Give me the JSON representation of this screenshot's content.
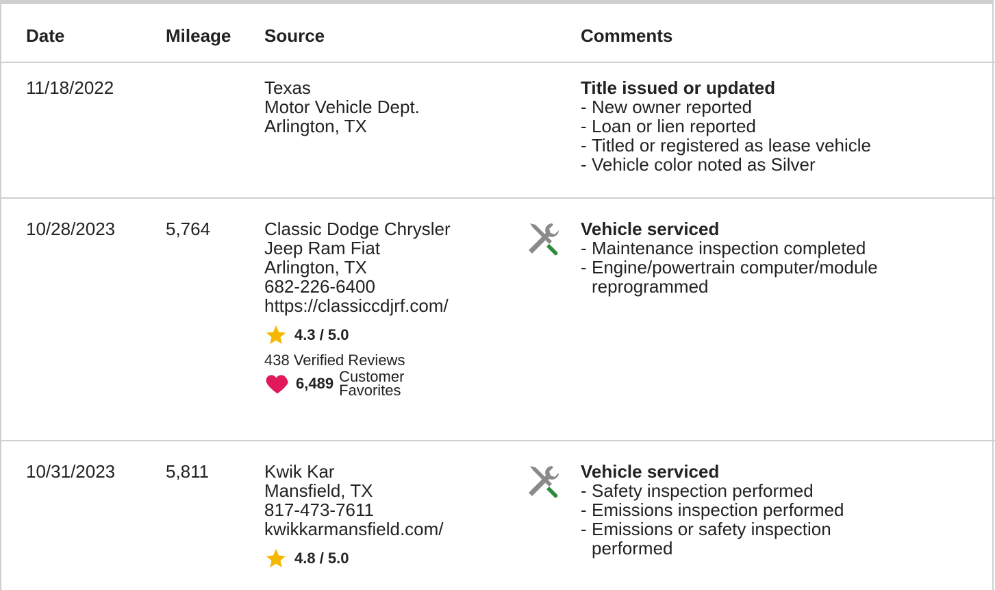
{
  "table": {
    "headers": {
      "date": "Date",
      "mileage": "Mileage",
      "source": "Source",
      "comments": "Comments"
    },
    "rows": [
      {
        "date": "11/18/2022",
        "mileage": "",
        "source": [
          "Texas",
          "Motor Vehicle Dept.",
          "Arlington, TX"
        ],
        "comment_title": "Title issued or updated",
        "comment_items": [
          "New owner reported",
          "Loan or lien reported",
          "Titled or registered as lease vehicle",
          "Vehicle color noted as Silver"
        ]
      },
      {
        "date": "10/28/2023",
        "mileage": "5,764",
        "source": [
          "Classic Dodge Chrysler",
          "Jeep Ram Fiat",
          "Arlington, TX",
          "682-226-6400",
          "https://classiccdjrf.com/"
        ],
        "rating": "4.3 / 5.0",
        "reviews": "438 Verified Reviews",
        "favorites_count": "6,489",
        "favorites_label_1": "Customer",
        "favorites_label_2": "Favorites",
        "comment_title": "Vehicle serviced",
        "comment_items": [
          "Maintenance inspection completed",
          "Engine/powertrain computer/module",
          "reprogrammed"
        ]
      },
      {
        "date": "10/31/2023",
        "mileage": "5,811",
        "source": [
          "Kwik Kar",
          "Mansfield, TX",
          "817-473-7611",
          "kwikkarmansfield.com/"
        ],
        "rating": "4.8 / 5.0",
        "comment_title": "Vehicle serviced",
        "comment_items": [
          "Safety inspection performed",
          "Emissions inspection performed",
          "Emissions or safety inspection",
          "performed"
        ]
      }
    ]
  },
  "icons": {
    "service": "wrench-screwdriver-icon",
    "star": "star-icon",
    "heart": "heart-icon"
  },
  "colors": {
    "star": "#f5b700",
    "heart": "#e0195a",
    "screwdriver_handle": "#2e8b3e",
    "tool_gray": "#8a8a8a",
    "border": "#cfcfcf"
  }
}
